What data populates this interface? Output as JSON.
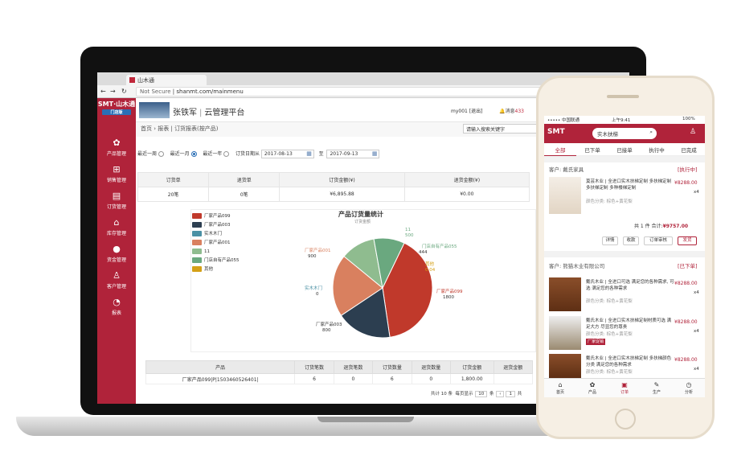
{
  "browser": {
    "tab_title": "山木通",
    "url_secure": "Not Secure",
    "url": "shanmt.com/mainmenu"
  },
  "app": {
    "logo": "SMT·山木通",
    "logo_sub": "门店版",
    "brand_user": "张铁军",
    "brand_sep": "|",
    "brand_title": "云管理平台",
    "user": "my001 [退出]",
    "msg_label": "消息",
    "msg_count": "433",
    "nav": [
      {
        "label": "产品管理",
        "icon": "products-icon",
        "glyph": "✿"
      },
      {
        "label": "销售管理",
        "icon": "cart-icon",
        "glyph": "🛒"
      },
      {
        "label": "订货管理",
        "icon": "clipboard-icon",
        "glyph": "📋"
      },
      {
        "label": "库存管理",
        "icon": "warehouse-icon",
        "glyph": "⌂"
      },
      {
        "label": "资金管理",
        "icon": "money-bag-icon",
        "glyph": "💰"
      },
      {
        "label": "客户管理",
        "icon": "user-icon",
        "glyph": "👤"
      },
      {
        "label": "报表",
        "icon": "pie-icon",
        "glyph": "◔"
      }
    ],
    "breadcrumb": [
      "首页",
      "报表",
      "订货报表(按产品)"
    ],
    "search_placeholder": "请输入搜索关键字",
    "filters": {
      "opt1": "最近一周",
      "opt2": "最近一月",
      "opt3": "最近一年",
      "range_label": "订货日期从",
      "from": "2017-08-13",
      "to_label": "至",
      "to": "2017-09-13"
    },
    "summary_headers": [
      "订货单",
      "退货单",
      "订货金额(¥)",
      "退货金额(¥)"
    ],
    "summary_values": [
      "20笔",
      "0笔",
      "¥6,895.88",
      "¥0.00"
    ],
    "detail_headers": [
      "产品",
      "订货笔数",
      "退货笔数",
      "订货数量",
      "退货数量",
      "订货金额",
      "退货金额"
    ],
    "detail_row": [
      "厂家产品099|P|1503460526401|",
      "6",
      "0",
      "6",
      "0",
      "1,800.00",
      ""
    ],
    "pager": {
      "total": "共计 10 条",
      "per_label": "每页显示",
      "per": "10",
      "unit": "条",
      "page": "1",
      "of": "共"
    }
  },
  "chart_data": {
    "type": "pie",
    "title": "产品订货量统计",
    "subtitle": "订货金额",
    "legend": [
      "厂家产品099",
      "厂家产品003",
      "实木木门",
      "厂家产品001",
      "11",
      "门店自有产品055",
      "其他"
    ],
    "colors": [
      "#c0392b",
      "#2c3e50",
      "#4a90a4",
      "#d9805f",
      "#8fbc8f",
      "#6aa87f",
      "#d4a017"
    ],
    "slices": [
      {
        "name": "厂家产品099",
        "value": 1800
      },
      {
        "name": "厂家产品003",
        "value": 800
      },
      {
        "name": "实木木门",
        "value": 0
      },
      {
        "name": "厂家产品001",
        "value": 900
      },
      {
        "name": "11",
        "value": 500
      },
      {
        "name": "门店自有产品055",
        "value": 444
      },
      {
        "name": "其他",
        "value": 0.04
      }
    ],
    "labels": {
      "p099": "厂家产品099",
      "v099": "1800",
      "p003": "厂家产品003",
      "v003": "800",
      "door": "实木木门",
      "vdoor": "0",
      "p001": "厂家产品001",
      "v001": "900",
      "p11": "11",
      "v11": "500",
      "p055": "门店自有产品055",
      "v055": "444",
      "other": "其他",
      "vother": "0.04"
    }
  },
  "phone": {
    "carrier": "••••• 中国联通",
    "time": "上午9:41",
    "battery": "100%",
    "logo": "SMT",
    "search": "实木扶梯",
    "tabs": [
      "全部",
      "已下单",
      "已接单",
      "执行中",
      "已完成"
    ],
    "order1": {
      "customer": "客户: 戴氏家具",
      "status": "[执行中]",
      "desc": "莫芸木业 | 全进口实木扶梯定制 多扶梯定制 多扶梯定制 多种楼梯定制",
      "attr": "颜色分类: 棕色+黄花梨",
      "price": "¥8288.00",
      "qty": "x4",
      "total_label": "共 1 件 合计:",
      "total": "¥9757.00",
      "btns": [
        "详情",
        "收款",
        "订单审核",
        "发货"
      ]
    },
    "order2": {
      "customer": "客户: 熊猫木业有限公司",
      "status": "[已下单]",
      "items": [
        {
          "desc": "戴氏木业 | 全进口可选 满足您的各种需求, 可选 满足您的各种需求",
          "attr": "颜色分类: 棕色+黄花梨",
          "price": "¥8288.00",
          "qty": "x4"
        },
        {
          "desc": "戴氏木业 | 全进口实木扶梯定制材质可选 满足大方 尽显您的尊贵",
          "attr": "颜色分类: 棕色+黄花梨",
          "badge": "厂家促销",
          "price": "¥8288.00",
          "qty": "x4"
        },
        {
          "desc": "戴氏木业 | 全进口实木扶梯定制 多扶梯颜色分类 满足您的各种需求",
          "attr": "颜色分类: 棕色+黄花梨",
          "price": "¥8288.00",
          "qty": "x4"
        }
      ]
    },
    "footer": [
      "首页",
      "产品",
      "订单",
      "生产",
      "分析"
    ]
  }
}
